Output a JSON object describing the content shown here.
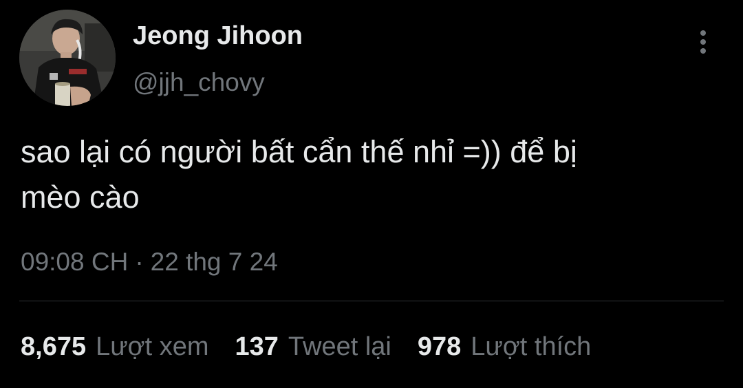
{
  "user": {
    "display_name": "Jeong Jihoon",
    "handle": "@jjh_chovy"
  },
  "tweet": {
    "text_line1": "sao lại có người bất cẩn thế nhỉ =)) để bị",
    "text_line2": "mèo cào",
    "time": "09:08 CH",
    "separator": "·",
    "date": "22 thg 7 24"
  },
  "stats": {
    "views_count": "8,675",
    "views_label": "Lượt xem",
    "retweets_count": "137",
    "retweets_label": "Tweet lại",
    "likes_count": "978",
    "likes_label": "Lượt thích"
  },
  "icons": {
    "more": "more-vertical-icon"
  },
  "colors": {
    "background": "#000000",
    "primary_text": "#e7e9ea",
    "secondary_text": "#71767b",
    "divider": "#2f3336"
  }
}
